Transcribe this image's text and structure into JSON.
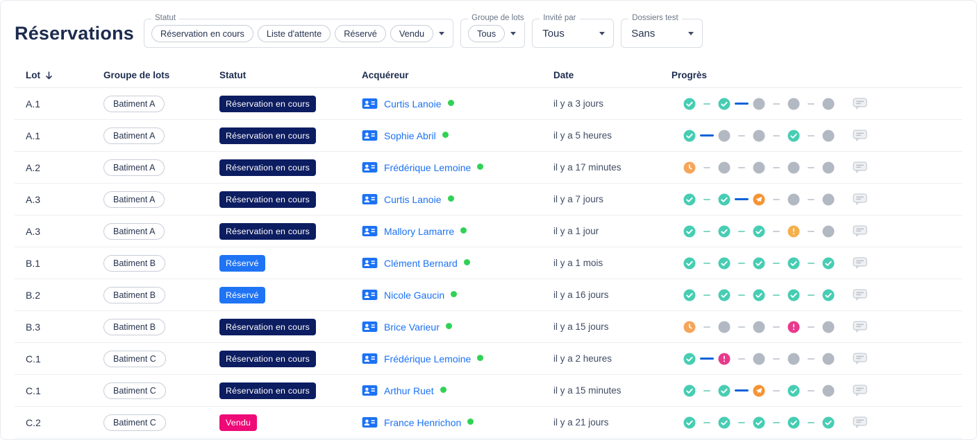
{
  "page": {
    "title": "Réservations"
  },
  "filters": {
    "statut": {
      "label": "Statut",
      "chips": [
        "Réservation en cours",
        "Liste d'attente",
        "Réservé",
        "Vendu"
      ]
    },
    "groupe_de_lots": {
      "label": "Groupe de lots",
      "chips": [
        "Tous"
      ]
    },
    "invite_par": {
      "label": "Invité par",
      "value": "Tous"
    },
    "dossiers_test": {
      "label": "Dossiers test",
      "value": "Sans"
    }
  },
  "table": {
    "columns": {
      "lot": "Lot",
      "groupe": "Groupe de lots",
      "statut": "Statut",
      "acquereur": "Acquéreur",
      "date": "Date",
      "progres": "Progrès"
    },
    "sort": {
      "column": "Lot",
      "direction": "desc"
    },
    "rows": [
      {
        "lot": "A.1",
        "groupe": "Batiment A",
        "status_label": "Réservation en cours",
        "status_type": "reservation",
        "acquereur": "Curtis Lanoie",
        "presence": true,
        "date": "il y a 3 jours",
        "steps": [
          "check",
          "check",
          "gray",
          "gray",
          "gray"
        ],
        "connectors": [
          "teal",
          "blue",
          "gray",
          "gray"
        ]
      },
      {
        "lot": "A.1",
        "groupe": "Batiment A",
        "status_label": "Réservation en cours",
        "status_type": "reservation",
        "acquereur": "Sophie Abril",
        "presence": true,
        "date": "il y a 5 heures",
        "steps": [
          "check",
          "gray",
          "gray",
          "check",
          "gray"
        ],
        "connectors": [
          "blue",
          "gray",
          "gray",
          "gray"
        ]
      },
      {
        "lot": "A.2",
        "groupe": "Batiment A",
        "status_label": "Réservation en cours",
        "status_type": "reservation",
        "acquereur": "Frédérique Lemoine",
        "presence": true,
        "date": "il y a 17 minutes",
        "steps": [
          "clock",
          "gray",
          "gray",
          "gray",
          "gray"
        ],
        "connectors": [
          "gray",
          "gray",
          "gray",
          "gray"
        ]
      },
      {
        "lot": "A.3",
        "groupe": "Batiment A",
        "status_label": "Réservation en cours",
        "status_type": "reservation",
        "acquereur": "Curtis Lanoie",
        "presence": true,
        "date": "il y a 7 jours",
        "steps": [
          "check",
          "check",
          "plane",
          "gray",
          "gray"
        ],
        "connectors": [
          "teal",
          "blue",
          "gray",
          "gray"
        ]
      },
      {
        "lot": "A.3",
        "groupe": "Batiment A",
        "status_label": "Réservation en cours",
        "status_type": "reservation",
        "acquereur": "Mallory Lamarre",
        "presence": true,
        "date": "il y a 1 jour",
        "steps": [
          "check",
          "check",
          "check",
          "warn_amber",
          "gray"
        ],
        "connectors": [
          "teal",
          "teal",
          "gray",
          "gray"
        ]
      },
      {
        "lot": "B.1",
        "groupe": "Batiment B",
        "status_label": "Réservé",
        "status_type": "reserve",
        "acquereur": "Clément Bernard",
        "presence": true,
        "date": "il y a 1 mois",
        "steps": [
          "check",
          "check",
          "check",
          "check",
          "check"
        ],
        "connectors": [
          "teal",
          "teal",
          "teal",
          "teal"
        ]
      },
      {
        "lot": "B.2",
        "groupe": "Batiment B",
        "status_label": "Réservé",
        "status_type": "reserve",
        "acquereur": "Nicole Gaucin",
        "presence": true,
        "date": "il y a 16 jours",
        "steps": [
          "check",
          "check",
          "check",
          "check",
          "check"
        ],
        "connectors": [
          "teal",
          "teal",
          "teal",
          "teal"
        ]
      },
      {
        "lot": "B.3",
        "groupe": "Batiment B",
        "status_label": "Réservation en cours",
        "status_type": "reservation",
        "acquereur": "Brice Varieur",
        "presence": true,
        "date": "il y a 15 jours",
        "steps": [
          "clock",
          "gray",
          "gray",
          "warn_pink",
          "gray"
        ],
        "connectors": [
          "gray",
          "gray",
          "gray",
          "gray"
        ]
      },
      {
        "lot": "C.1",
        "groupe": "Batiment C",
        "status_label": "Réservation en cours",
        "status_type": "reservation",
        "acquereur": "Frédérique Lemoine",
        "presence": true,
        "date": "il y a 2 heures",
        "steps": [
          "check",
          "warn_pink",
          "gray",
          "gray",
          "gray"
        ],
        "connectors": [
          "blue",
          "gray",
          "gray",
          "gray"
        ]
      },
      {
        "lot": "C.1",
        "groupe": "Batiment C",
        "status_label": "Réservation en cours",
        "status_type": "reservation",
        "acquereur": "Arthur Ruet",
        "presence": true,
        "date": "il y a 15 minutes",
        "steps": [
          "check",
          "check",
          "plane",
          "check",
          "gray"
        ],
        "connectors": [
          "teal",
          "blue",
          "gray",
          "gray"
        ]
      },
      {
        "lot": "C.2",
        "groupe": "Batiment C",
        "status_label": "Vendu",
        "status_type": "vendu",
        "acquereur": "France Henrichon",
        "presence": true,
        "date": "il y a 21 jours",
        "steps": [
          "check",
          "check",
          "check",
          "check",
          "check"
        ],
        "connectors": [
          "teal",
          "teal",
          "teal",
          "teal"
        ]
      }
    ]
  },
  "colors": {
    "status_reservation": "#0d1d61",
    "status_reserve": "#1f74f5",
    "status_vendu": "#ee0a77",
    "link_blue": "#1c72f4",
    "presence_green": "#2fd254",
    "step_teal": "#47cdb3",
    "step_gray": "#b3b9c3",
    "step_clock": "#f5a65b",
    "step_plane": "#f69333",
    "step_warn_amber": "#f3b04d",
    "step_warn_pink": "#e83a8c",
    "connector_blue": "#0f62d9",
    "connector_gray": "#c9cfd8",
    "connector_teal": "#82d7c5",
    "text_dark": "#1c2b4e",
    "text_body": "#2a3550"
  }
}
